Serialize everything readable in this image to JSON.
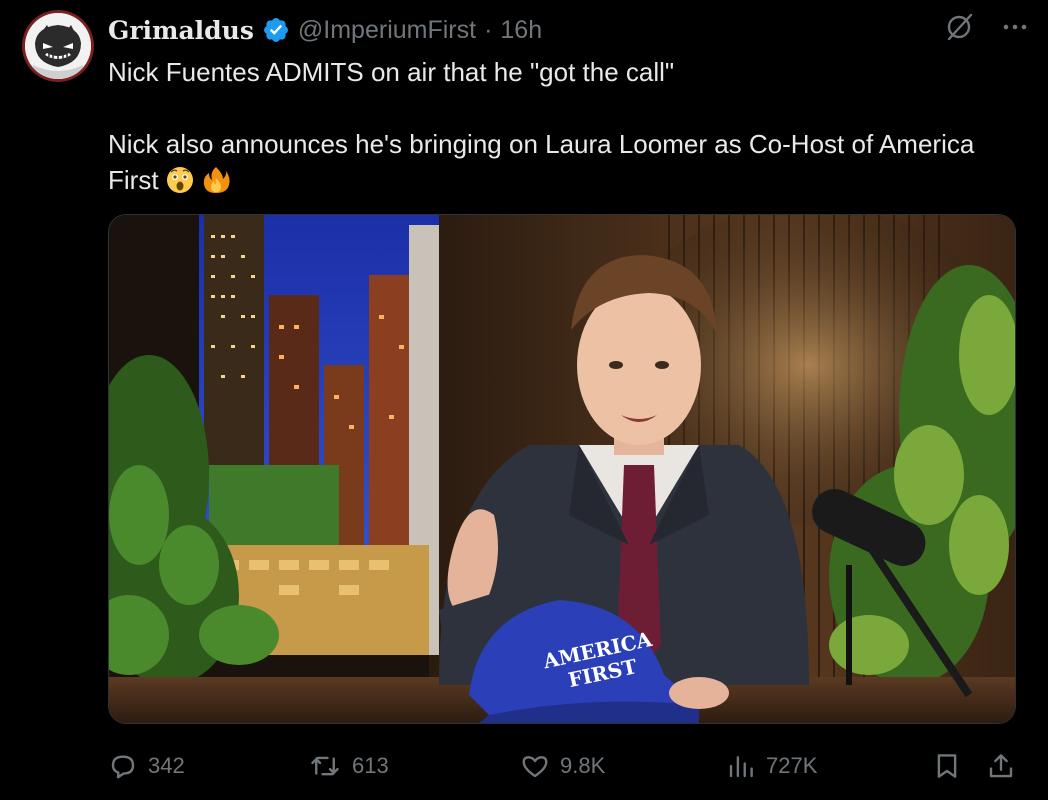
{
  "author": {
    "display_name": "Grimaldus",
    "handle": "@ImperiumFirst",
    "separator": "·",
    "time": "16h"
  },
  "tweet": {
    "line1": "Nick Fuentes ADMITS on air that he \"got the call\"",
    "line2": "Nick also announces he's bringing on Laura Loomer as Co-Host of America",
    "line3": "First",
    "emojis": [
      "astonished-face",
      "fire"
    ]
  },
  "media": {
    "hat_text_line1": "AMERICA",
    "hat_text_line2": "FIRST"
  },
  "actions": {
    "replies": "342",
    "reposts": "613",
    "likes": "9.8K",
    "views": "727K"
  },
  "colors": {
    "background": "#000000",
    "text": "#e7e9ea",
    "muted": "#71767b",
    "verified": "#1d9bf0"
  },
  "icons": [
    "reply-icon",
    "repost-icon",
    "like-icon",
    "views-icon",
    "bookmark-icon",
    "share-icon",
    "grok-icon",
    "more-icon",
    "verified-icon"
  ]
}
